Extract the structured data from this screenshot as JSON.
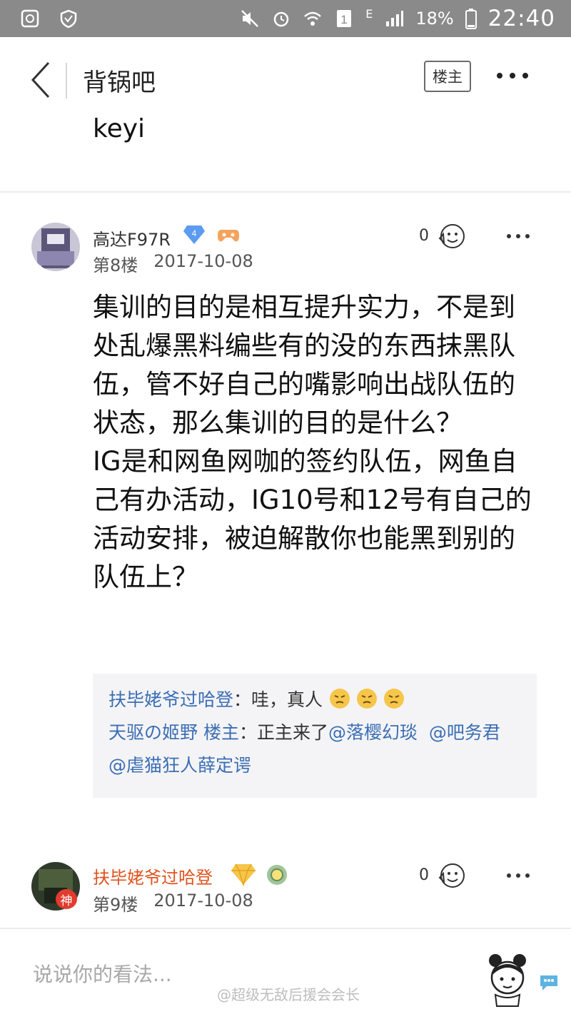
{
  "status_bar": {
    "signal_letter": "E",
    "sim_slot": "1",
    "battery": "18%",
    "time": "22:40"
  },
  "header": {
    "title": "背锅吧",
    "op_only_label": "楼主"
  },
  "previous_post_text": "keyi",
  "posts": [
    {
      "username": "高达F97R",
      "level_badge": "4",
      "floor": "第8楼",
      "date": "2017-10-08",
      "likes": "0",
      "body": [
        "集训的目的是相互提升实力，不是到处乱爆黑料编些有的没的东西抹黑队伍，管不好自己的嘴影响出战队伍的状态，那么集训的目的是什么？",
        "IG是和网鱼网咖的签约队伍，网鱼自己有办活动，IG10号和12号有自己的活动安排，被迫解散你也能黑到别的队伍上？"
      ],
      "replies": [
        {
          "name": "扶毕姥爷过哈登",
          "sep": "：",
          "text": "哇，真人"
        },
        {
          "name": "天驱の姬野 楼主",
          "sep": "：",
          "text": "正主来了",
          "mentions": [
            "@落樱幻琰",
            "@吧务君",
            "@虐猫狂人薛定谔"
          ]
        }
      ]
    },
    {
      "username": "扶毕姥爷过哈登",
      "avatar_badge": "神",
      "floor": "第9楼",
      "date": "2017-10-08",
      "likes": "0"
    }
  ],
  "comment_input": {
    "placeholder": "说说你的看法..."
  },
  "watermark": "@超级无敌后援会会长",
  "colors": {
    "status_bar": "#8a8a8a",
    "link_blue": "#3b6eb5",
    "username_gray": "#333333",
    "username_orange": "#e0531e",
    "reply_bg": "#f4f4f6"
  },
  "icons": [
    "back-arrow-icon",
    "more-dots-icon",
    "level-diamond-icon",
    "game-controller-icon",
    "like-face-icon",
    "gem-badge-icon",
    "emblem-badge-icon",
    "annoyed-face-emoji"
  ]
}
